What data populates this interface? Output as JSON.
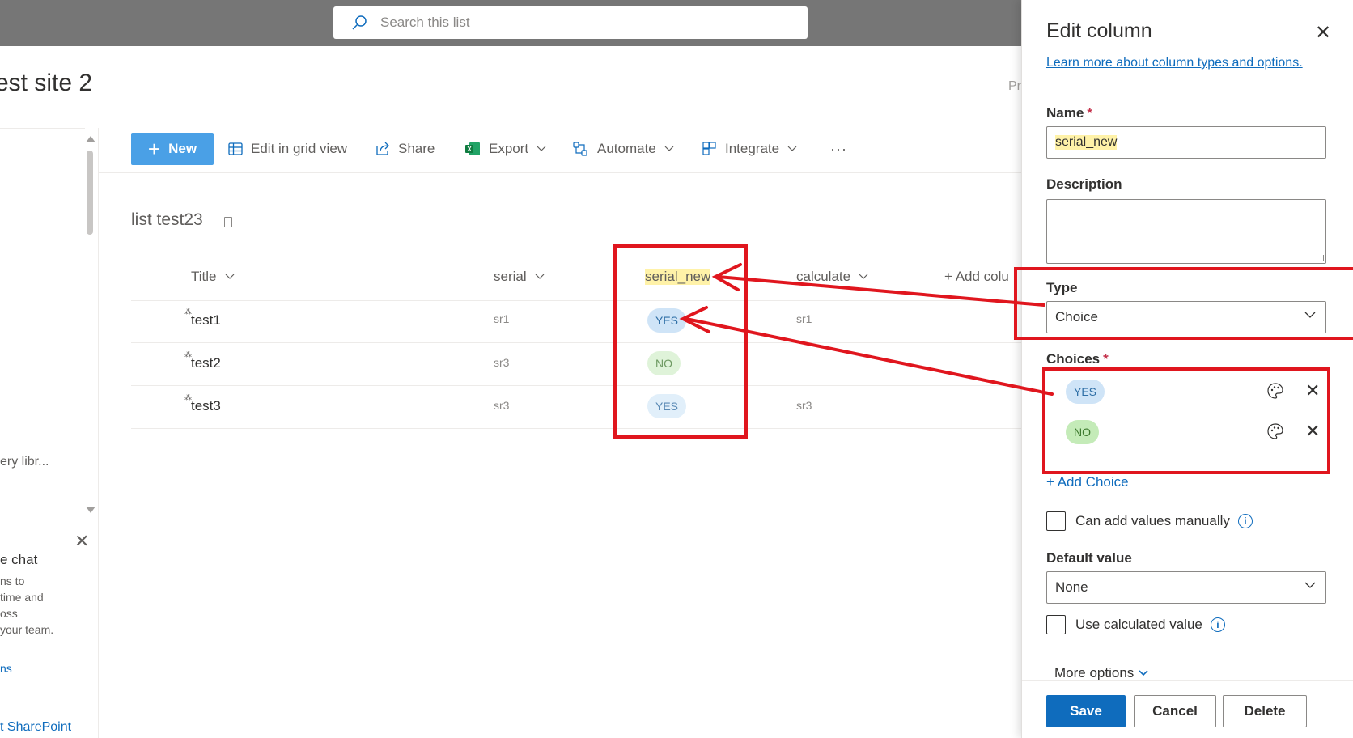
{
  "search": {
    "placeholder": "Search this list"
  },
  "site": {
    "title": "est site 2",
    "partial_right": "Pr"
  },
  "leftnav": {
    "library_item": "ery libr...",
    "chat": {
      "title": "e chat",
      "description": "ns to\ntime and\noss\nyour team.",
      "link": "ns"
    },
    "sharepoint_link": "t SharePoint"
  },
  "commands": {
    "new": "New",
    "edit_grid": "Edit in grid view",
    "share": "Share",
    "export": "Export",
    "automate": "Automate",
    "integrate": "Integrate",
    "more": "···"
  },
  "list": {
    "title": "list test23",
    "columns": [
      "Title",
      "serial",
      "serial_new",
      "calculate",
      "+ Add colu"
    ],
    "rows": [
      {
        "title": "test1",
        "serial": "sr1",
        "serial_new": "YES",
        "calculate": "sr1"
      },
      {
        "title": "test2",
        "serial": "sr3",
        "serial_new": "NO",
        "calculate": ""
      },
      {
        "title": "test3",
        "serial": "sr3",
        "serial_new": "YES",
        "calculate": "sr3"
      }
    ]
  },
  "panel": {
    "title": "Edit column",
    "learn_more": "Learn more about column types and options.",
    "name_label": "Name",
    "name_required": "*",
    "name_value": "serial_new",
    "description_label": "Description",
    "type_label": "Type",
    "type_value": "Choice",
    "choices_label": "Choices",
    "choices_required": "*",
    "choices": [
      "YES",
      "NO"
    ],
    "add_choice": "+ Add Choice",
    "can_add_manually": "Can add values manually",
    "default_value_label": "Default value",
    "default_value": "None",
    "use_calculated": "Use calculated value",
    "more_options": "More options",
    "save": "Save",
    "cancel": "Cancel",
    "delete": "Delete"
  },
  "colors": {
    "accent": "#0f6cbd",
    "new_button": "#4aa0e6",
    "annotation_red": "#e0161e",
    "highlight": "#fff2a8",
    "yes_pill": "#e1effa",
    "no_pill": "#dff3d9"
  }
}
